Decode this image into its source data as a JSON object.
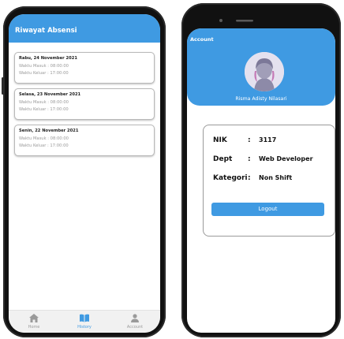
{
  "history": {
    "title": "Riwayat Absensi",
    "records": [
      {
        "date": "Rabu, 24 November 2021",
        "masuk": "Waktu Masuk : 08:00:00",
        "keluar": "Waktu Keluar : 17:00:00"
      },
      {
        "date": "Selasa, 23 November 2021",
        "masuk": "Waktu Masuk : 08:00:00",
        "keluar": "Waktu Keluar : 17:00:00"
      },
      {
        "date": "Senin, 22 November 2021",
        "masuk": "Waktu Masuk : 08:00:00",
        "keluar": "Waktu Keluar : 17:00:00"
      }
    ]
  },
  "nav": {
    "home": "Home",
    "history": "History",
    "account": "Account"
  },
  "account": {
    "title": "Account",
    "name": "Risma Adisty Nilasari",
    "rows": [
      {
        "key": "NIK",
        "colon": ":",
        "value": "3117"
      },
      {
        "key": "Dept",
        "colon": ":",
        "value": "Web Developer"
      },
      {
        "key": "Kategori",
        "colon": ":",
        "value": "Non Shift"
      }
    ],
    "logout": "Logout"
  },
  "colors": {
    "accent": "#3f9ae2"
  }
}
